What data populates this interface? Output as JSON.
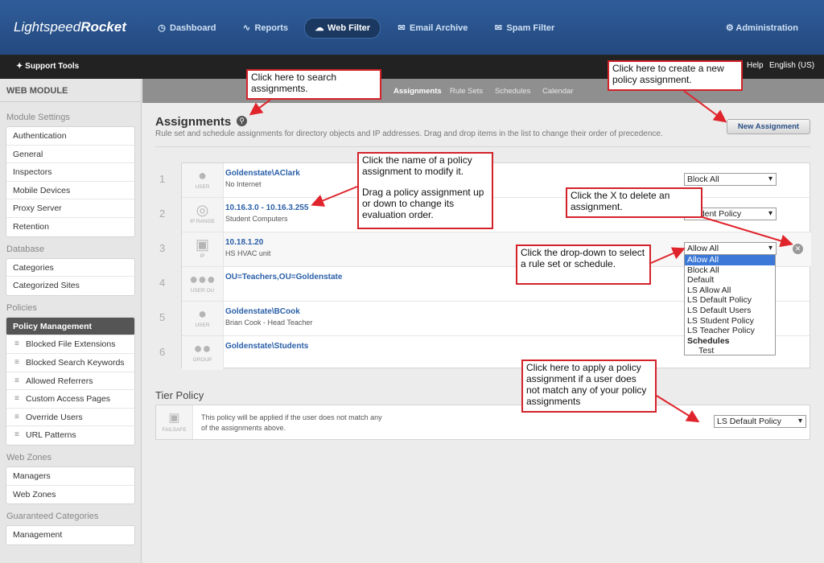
{
  "header": {
    "logo_light": "Lightspeed",
    "logo_bold": "Rocket",
    "nav": [
      {
        "label": "Dashboard",
        "icon": "dashboard-icon"
      },
      {
        "label": "Reports",
        "icon": "reports-icon"
      },
      {
        "label": "Web Filter",
        "icon": "web-filter-icon",
        "active": true
      },
      {
        "label": "Email Archive",
        "icon": "email-archive-icon"
      },
      {
        "label": "Spam Filter",
        "icon": "spam-filter-icon"
      }
    ],
    "admin": "Administration"
  },
  "subbar": {
    "support": "Support Tools",
    "help": "Help",
    "language": "English (US)"
  },
  "sidebar": {
    "title": "WEB MODULE",
    "sections": [
      {
        "label": "Module Settings",
        "items": [
          "Authentication",
          "General",
          "Inspectors",
          "Mobile Devices",
          "Proxy Server",
          "Retention"
        ]
      },
      {
        "label": "Database",
        "items": [
          "Categories",
          "Categorized Sites"
        ]
      },
      {
        "label": "Policies",
        "active": "Policy Management",
        "items": [
          "Policy Management",
          "Blocked File Extensions",
          "Blocked Search Keywords",
          "Allowed Referrers",
          "Custom Access Pages",
          "Override Users",
          "URL Patterns"
        ]
      },
      {
        "label": "Web Zones",
        "items": [
          "Managers",
          "Web Zones"
        ]
      },
      {
        "label": "Guaranteed Categories",
        "items": [
          "Management"
        ]
      }
    ]
  },
  "tabs": [
    "Assignments",
    "Rule Sets",
    "Schedules",
    "Calendar"
  ],
  "page": {
    "title": "Assignments",
    "description": "Rule set and schedule assignments for directory objects and IP addresses. Drag and drop items in the list to change their order of precedence.",
    "new_button": "New Assignment"
  },
  "assignments": [
    {
      "num": "1",
      "type": "USER",
      "name": "Goldenstate\\AClark",
      "desc": "No Internet",
      "policy": "Block All"
    },
    {
      "num": "2",
      "type": "IP RANGE",
      "name": "10.16.3.0 - 10.16.3.255",
      "desc": "Student Computers",
      "policy": "Student Policy"
    },
    {
      "num": "3",
      "type": "IP",
      "name": "10.18.1.20",
      "desc": "HS HVAC unit",
      "policy": "Allow All"
    },
    {
      "num": "4",
      "type": "USER OU",
      "name": "OU=Teachers,OU=Goldenstate",
      "desc": "",
      "policy": ""
    },
    {
      "num": "5",
      "type": "USER",
      "name": "Goldenstate\\BCook",
      "desc": "Brian Cook - Head Teacher",
      "policy": ""
    },
    {
      "num": "6",
      "type": "GROUP",
      "name": "Goldenstate\\Students",
      "desc": "",
      "policy": ""
    }
  ],
  "dropdown_options": [
    "Allow All",
    "Block All",
    "Default",
    "LS Allow All",
    "LS Default Policy",
    "LS Default Users",
    "LS Student Policy",
    "LS Teacher Policy"
  ],
  "dropdown_group": "Schedules",
  "dropdown_group_items": [
    "Test"
  ],
  "tier": {
    "title": "Tier Policy",
    "icon_label": "FAILSAFE",
    "text": "This policy will be applied if the user does not match any of the assignments above.",
    "policy": "LS Default Policy"
  },
  "callouts": {
    "search": "Click here to search assignments.",
    "new": "Click here to create a new policy assignment.",
    "name_line1": "Click the name of a policy assignment to modify it.",
    "name_line2": "Drag a policy assignment up or down to change its evaluation order.",
    "delete": "Click the X to delete an assignment.",
    "dropdown": "Click the drop-down to select a rule set or schedule.",
    "tier": "Click here to apply a policy assignment if a user does not match any of your policy assignments"
  },
  "colors": {
    "header": "#2f5d9a",
    "link": "#2a5fa8",
    "callout_border": "#d3222a",
    "selected": "#3b78d8"
  }
}
